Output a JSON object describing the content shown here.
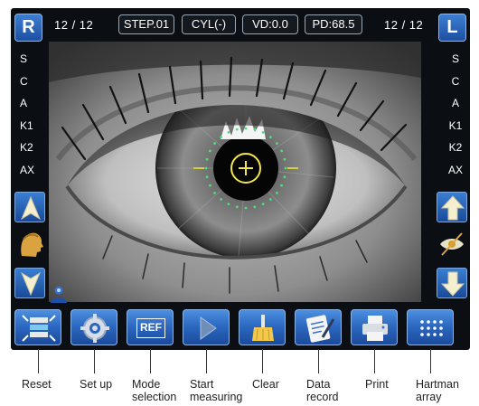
{
  "header": {
    "right_eye_label": "R",
    "left_eye_label": "L",
    "right_count": "12 / 12",
    "left_count": "12 / 12",
    "step": "STEP.01",
    "cyl": "CYL(-)",
    "vd": "VD:0.0",
    "pd": "PD:68.5"
  },
  "measurements_left": [
    "S",
    "C",
    "A",
    "K1",
    "K2",
    "AX"
  ],
  "measurements_right": [
    "S",
    "C",
    "A",
    "K1",
    "K2",
    "AX"
  ],
  "toolbar": [
    {
      "name": "reset",
      "label_lines": [
        "Reset"
      ]
    },
    {
      "name": "setup",
      "label_lines": [
        "Set up"
      ]
    },
    {
      "name": "mode",
      "label_lines": [
        "Mode",
        "selection"
      ],
      "button_text": "REF"
    },
    {
      "name": "start",
      "label_lines": [
        "Start",
        "measuring"
      ]
    },
    {
      "name": "clear",
      "label_lines": [
        "Clear"
      ]
    },
    {
      "name": "data",
      "label_lines": [
        "Data",
        "record"
      ]
    },
    {
      "name": "print",
      "label_lines": [
        "Print"
      ]
    },
    {
      "name": "hartman",
      "label_lines": [
        "Hartman",
        "array"
      ]
    }
  ],
  "colors": {
    "accent_blue": "#2a66bf",
    "reticle_yellow": "#f2e84a",
    "dot_green": "#4ee07a"
  },
  "icons": {
    "left_up": "arrow-up-icon",
    "left_head": "head-icon",
    "left_down": "arrow-down-icon",
    "right_up": "arrow-up-icon",
    "right_eye_toggle": "eye-icon",
    "right_down": "arrow-down-icon",
    "user": "user-icon"
  }
}
